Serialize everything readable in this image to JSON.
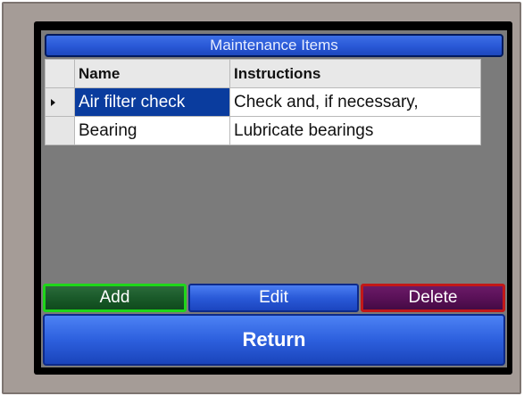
{
  "title": "Maintenance Items",
  "grid": {
    "columns": [
      "Name",
      "Instructions"
    ],
    "rows": [
      {
        "name": "Air filter check",
        "instructions": "Check and, if necessary,",
        "selected": true
      },
      {
        "name": "Bearing",
        "instructions": "Lubricate bearings",
        "selected": false
      }
    ]
  },
  "buttons": {
    "add": "Add",
    "edit": "Edit",
    "delete": "Delete",
    "return": "Return"
  },
  "colors": {
    "title_bar": "#2958d6",
    "selected_row": "#0a3c9e",
    "add_border": "#1fd619",
    "delete_border": "#c21818",
    "bezel": "#a59c97"
  }
}
